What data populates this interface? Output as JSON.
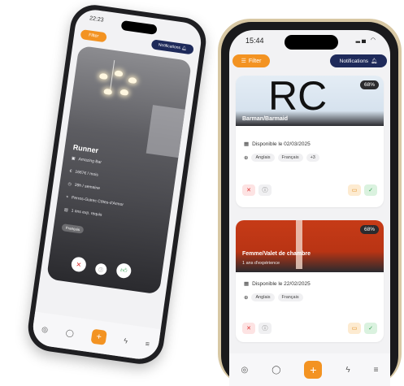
{
  "left_phone": {
    "time": "22:23",
    "filter_label": "Filter",
    "notifications_label": "Notifications",
    "card": {
      "title": "Runner",
      "rows": [
        {
          "icon": "building-icon",
          "text": "Amazing Bar"
        },
        {
          "icon": "euro-icon",
          "text": "1667€ / mois"
        },
        {
          "icon": "clock-icon",
          "text": "39h / semaine"
        },
        {
          "icon": "pin-icon",
          "text": "Perros-Guirec Côtes-d'Armor"
        },
        {
          "icon": "contract-icon",
          "text": "1 ans exp. requis"
        }
      ],
      "language_chip": "Français"
    },
    "tabs": [
      "compass-icon",
      "chat-icon",
      "plus-icon",
      "bolt-icon",
      "settings-icon"
    ]
  },
  "right_phone": {
    "time": "15:44",
    "filter_label": "Filter",
    "notifications_label": "Notifications",
    "cards": [
      {
        "banner_text": "RC",
        "percent": "68%",
        "job_title": "Barman/Barmaid",
        "subtitle": "",
        "available": "Disponible le 02/03/2025",
        "languages": [
          "Anglais",
          "Français",
          "+3"
        ]
      },
      {
        "banner_text": "",
        "percent": "68%",
        "job_title": "Femme/Valet de chambre",
        "subtitle": "1 ans d'expérience",
        "available": "Disponible le 22/02/2025",
        "languages": [
          "Anglais",
          "Français"
        ]
      }
    ],
    "tabs": [
      "compass-icon",
      "chat-icon",
      "plus-icon",
      "bolt-icon",
      "settings-icon"
    ]
  },
  "colors": {
    "accent": "#f39322",
    "navy": "#1e2a5a",
    "banner_red": "#c63b17",
    "banner_light": "#dde8f2"
  }
}
